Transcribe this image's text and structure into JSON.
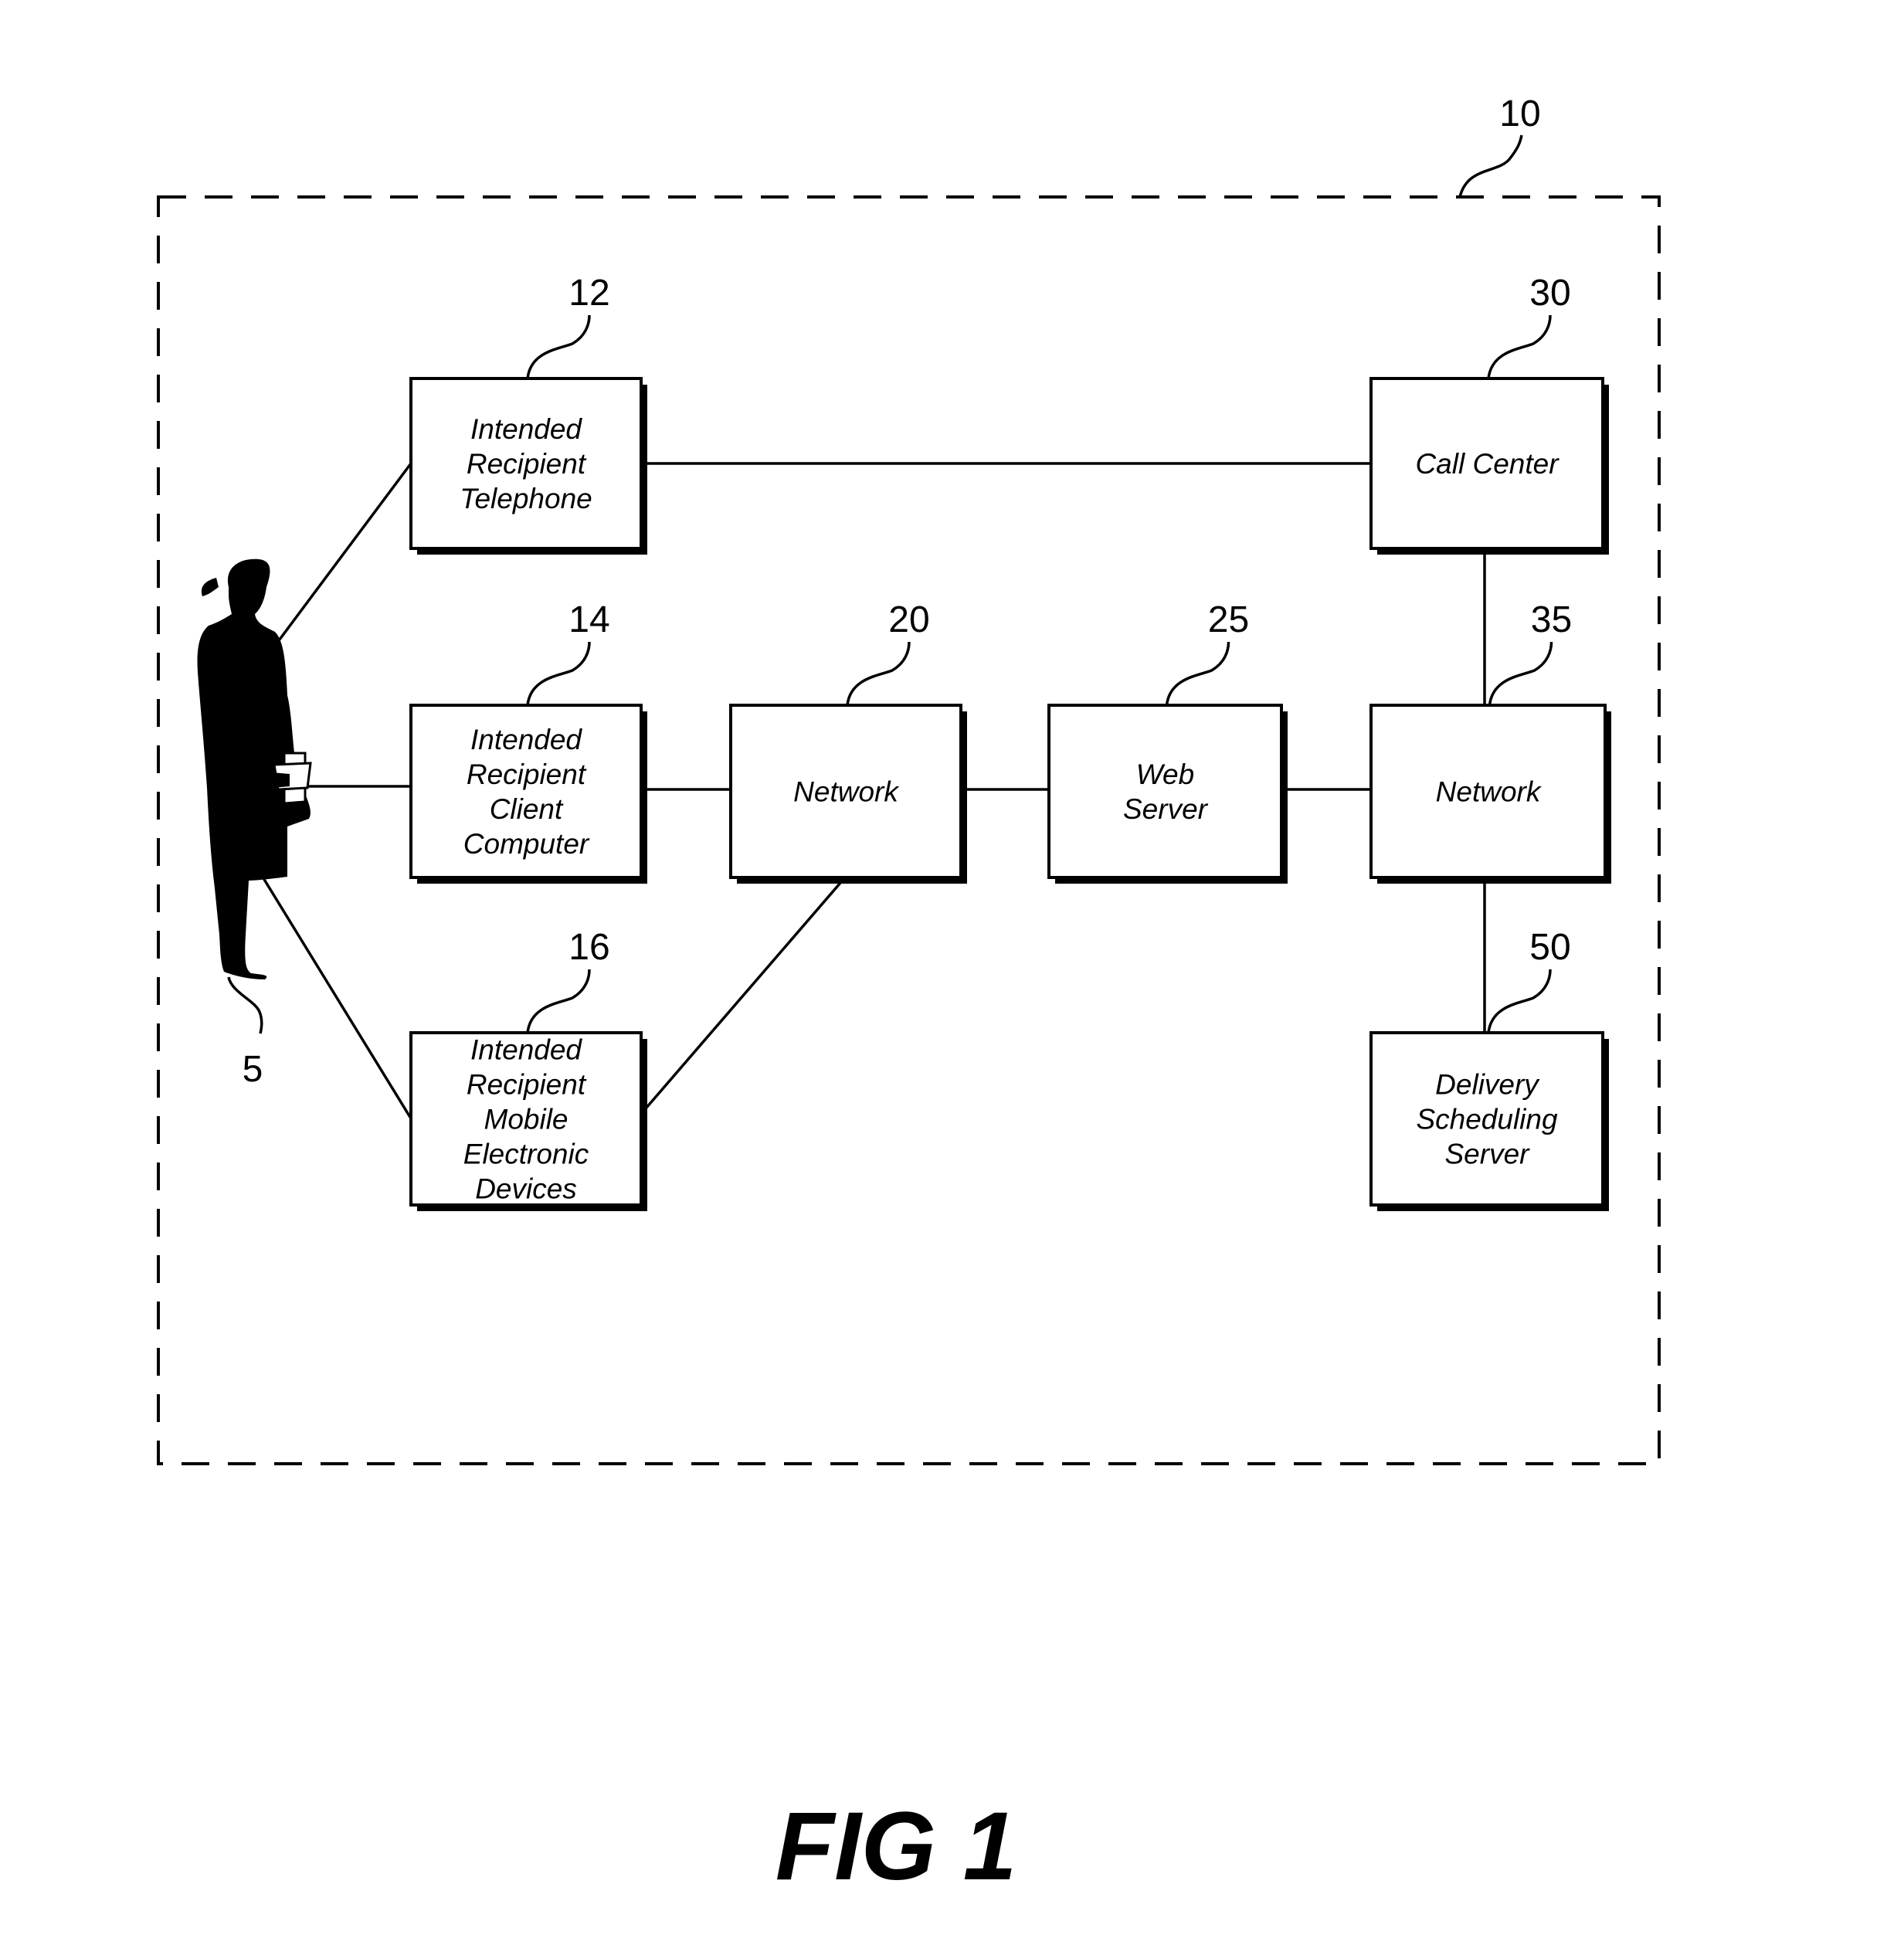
{
  "figure": {
    "caption": "FIG 1",
    "system_ref": "10"
  },
  "person": {
    "ref": "5",
    "description": "intended recipient (silhouette of woman holding books)"
  },
  "nodes": [
    {
      "id": "telephone",
      "ref": "12",
      "lines": [
        "Intended",
        "Recipient",
        "Telephone"
      ]
    },
    {
      "id": "client-computer",
      "ref": "14",
      "lines": [
        "Intended",
        "Recipient",
        "Client",
        "Computer"
      ]
    },
    {
      "id": "mobile-devices",
      "ref": "16",
      "lines": [
        "Intended",
        "Recipient",
        "Mobile",
        "Electronic",
        "Devices"
      ]
    },
    {
      "id": "network-20",
      "ref": "20",
      "lines": [
        "Network"
      ]
    },
    {
      "id": "web-server",
      "ref": "25",
      "lines": [
        "Web",
        "Server"
      ]
    },
    {
      "id": "call-center",
      "ref": "30",
      "lines": [
        "Call Center"
      ]
    },
    {
      "id": "network-35",
      "ref": "35",
      "lines": [
        "Network"
      ]
    },
    {
      "id": "delivery-scheduling-server",
      "ref": "50",
      "lines": [
        "Delivery",
        "Scheduling",
        "Server"
      ]
    }
  ],
  "edges": [
    {
      "from": "person",
      "to": "telephone"
    },
    {
      "from": "person",
      "to": "client-computer"
    },
    {
      "from": "person",
      "to": "mobile-devices"
    },
    {
      "from": "telephone",
      "to": "call-center"
    },
    {
      "from": "client-computer",
      "to": "network-20"
    },
    {
      "from": "mobile-devices",
      "to": "network-20"
    },
    {
      "from": "network-20",
      "to": "web-server"
    },
    {
      "from": "web-server",
      "to": "network-35"
    },
    {
      "from": "call-center",
      "to": "network-35"
    },
    {
      "from": "network-35",
      "to": "delivery-scheduling-server"
    }
  ]
}
